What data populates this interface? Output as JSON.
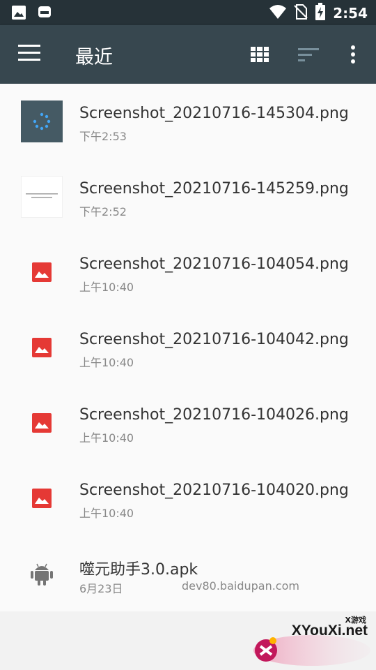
{
  "status_bar": {
    "time": "2:54",
    "left_icons": [
      "image-notification-icon",
      "app-notification-icon"
    ],
    "right_icons": [
      "wifi-icon",
      "no-sim-icon",
      "battery-charging-icon"
    ]
  },
  "toolbar": {
    "title": "最近",
    "menu_icon": "hamburger-icon",
    "actions": [
      "grid-view-icon",
      "sort-icon",
      "more-vert-icon"
    ]
  },
  "files": [
    {
      "name": "Screenshot_20210716-145304.png",
      "meta": "下午2:53",
      "thumbnail": "loading-screenshot"
    },
    {
      "name": "Screenshot_20210716-145259.png",
      "meta": "下午2:52",
      "thumbnail": "text-screenshot"
    },
    {
      "name": "Screenshot_20210716-104054.png",
      "meta": "上午10:40",
      "icon": "image-icon"
    },
    {
      "name": "Screenshot_20210716-104042.png",
      "meta": "上午10:40",
      "icon": "image-icon"
    },
    {
      "name": "Screenshot_20210716-104026.png",
      "meta": "上午10:40",
      "icon": "image-icon"
    },
    {
      "name": "Screenshot_20210716-104020.png",
      "meta": "上午10:40",
      "icon": "image-icon"
    },
    {
      "name": "噬元助手3.0.apk",
      "meta": "6月23日",
      "source": "dev80.baidupan.com",
      "icon": "android-icon"
    }
  ],
  "watermark": {
    "main": "XYouXi.net",
    "sub": "X游戏"
  },
  "colors": {
    "status_bar": "#263238",
    "toolbar": "#37474f",
    "image_icon": "#e53935",
    "android_icon": "#757575",
    "loading_dots": "#42a5f5"
  }
}
